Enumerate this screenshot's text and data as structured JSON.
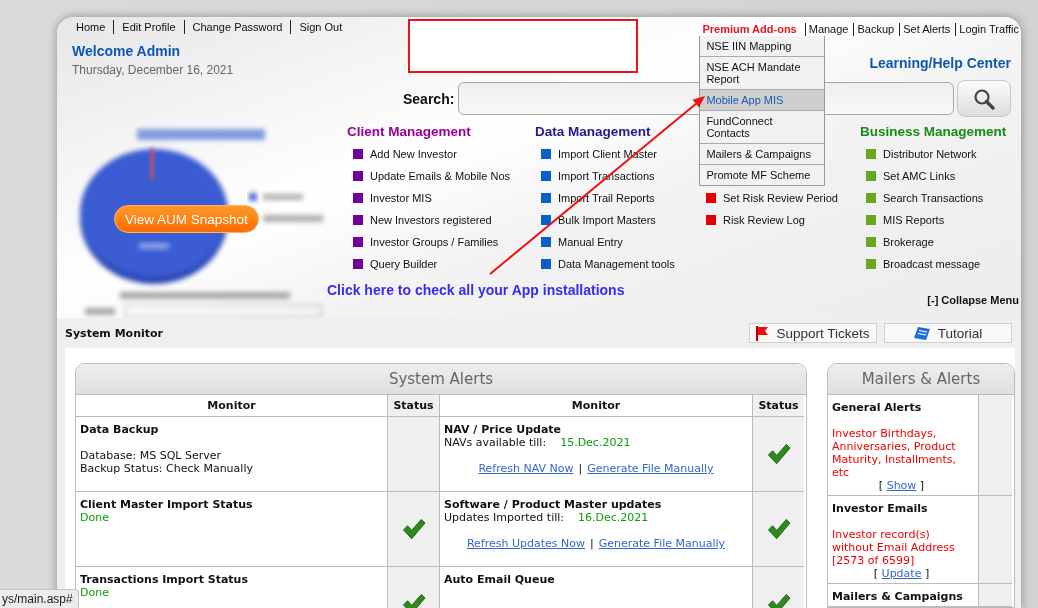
{
  "top_nav": {
    "links": [
      "Home",
      "Edit Profile",
      "Change Password",
      "Sign Out"
    ]
  },
  "welcome": {
    "title": "Welcome Admin",
    "date": "Thursday, December 16, 2021"
  },
  "admin_menu": {
    "premium": "Premium Add-ons",
    "links": [
      "Manage",
      "Backup",
      "Set Alerts",
      "Login Traffic"
    ],
    "dropdown": [
      {
        "label": "NSE IIN Mapping",
        "selected": false
      },
      {
        "label": "NSE ACH Mandate Report",
        "selected": false
      },
      {
        "label": "Mobile App MIS",
        "selected": true
      },
      {
        "label": "FundConnect Contacts",
        "selected": false
      },
      {
        "label": "Mailers & Campaigns",
        "selected": false
      },
      {
        "label": "Promote MF Scheme",
        "selected": false
      }
    ]
  },
  "help_link": "Learning/Help Center",
  "search": {
    "label": "Search:"
  },
  "aum_snapshot": {
    "button": "View AUM Snapshot"
  },
  "menu_columns": [
    {
      "title": {
        "text": "Client Management",
        "color": "#990099"
      },
      "color": "#72009e",
      "items": [
        "Add New Investor",
        "Update Emails & Mobile Nos",
        "Investor MIS",
        "New Investors registered",
        "Investor Groups / Families",
        "Query Builder"
      ]
    },
    {
      "title": {
        "text": "Data Management",
        "color": "#201a8c"
      },
      "color": "#0b5fcc",
      "items": [
        "Import Client Master",
        "Import Transactions",
        "Import Trail Reports",
        "Bulk Import Masters",
        "Manual Entry",
        "Data Management tools"
      ]
    },
    {
      "color": "#e00000",
      "items": [
        "Set Risk Review Period",
        "Risk Review Log"
      ]
    },
    {
      "title": {
        "text": "Business Management",
        "color": "#168c16"
      },
      "color": "#67a723",
      "items": [
        "Distributor Network",
        "Set AMC Links",
        "Search Transactions",
        "MIS Reports",
        "Brokerage",
        "Broadcast message"
      ]
    }
  ],
  "app_link": "Click here to check all your App installations",
  "collapse_menu": "[-] Collapse Menu",
  "system_monitor": {
    "title": "System Monitor",
    "buttons": [
      {
        "label": "Support Tickets",
        "kind": "flag"
      },
      {
        "label": "Tutorial",
        "kind": "book"
      }
    ]
  },
  "system_alerts": {
    "title": "System Alerts",
    "columns": [
      "Monitor",
      "Status",
      "Monitor",
      "Status"
    ],
    "rows": [
      [
        {
          "title": "Data Backup",
          "lines": [
            {
              "kind": "text",
              "text": "Database: MS SQL Server"
            },
            {
              "kind": "text",
              "text": "Backup Status: Check Manually"
            }
          ],
          "status_ok": false
        },
        {
          "title": "NAV / Price Update",
          "lines": [
            {
              "kind": "date",
              "label": "NAVs available till:",
              "value": "15.Dec.2021"
            },
            {
              "kind": "links",
              "links": [
                "Refresh NAV Now",
                "Generate File Manually"
              ],
              "separator": "|"
            }
          ],
          "status_ok": true
        }
      ],
      [
        {
          "title": "Client Master Import Status",
          "lines": [
            {
              "kind": "done",
              "text": "Done"
            }
          ],
          "status_ok": true
        },
        {
          "title": "Software / Product Master updates",
          "lines": [
            {
              "kind": "date",
              "label": "Updates Imported till:",
              "value": "16.Dec.2021"
            },
            {
              "kind": "links",
              "links": [
                "Refresh Updates Now",
                "Generate File Manually"
              ],
              "separator": "|"
            }
          ],
          "status_ok": true
        }
      ],
      [
        {
          "title": "Transactions Import Status",
          "lines": [
            {
              "kind": "done",
              "text": "Done"
            }
          ],
          "status_ok": true
        },
        {
          "title": "Auto Email Queue",
          "status_ok": true
        }
      ]
    ]
  },
  "mailers_alerts": {
    "title": "Mailers & Alerts",
    "items": [
      {
        "title": "General Alerts",
        "alert": "Investor Birthdays, Anniversaries, Product Maturity, Installments, etc",
        "action": {
          "open": "[",
          "link": "Show",
          "close": "]"
        }
      },
      {
        "title": "Investor Emails",
        "alert": "Investor record(s) without Email Address [2573 of 6599]",
        "action": {
          "open": "[",
          "link": "Update",
          "close": "]"
        }
      },
      {
        "title": "Mailers & Campaigns"
      }
    ]
  },
  "status_url": "ys/main.asp#"
}
